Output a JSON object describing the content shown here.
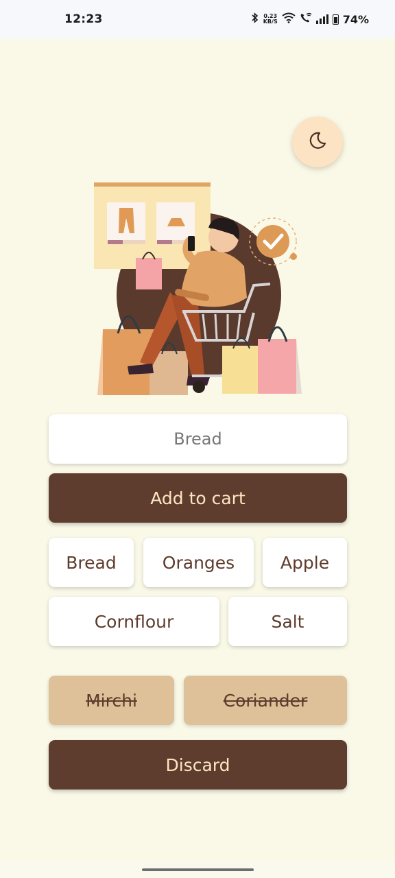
{
  "status_bar": {
    "time": "12:23",
    "net_speed_value": "0.23",
    "net_speed_unit": "KB/S",
    "battery_percent": "74%"
  },
  "theme_toggle": {
    "icon": "moon-icon"
  },
  "illustration": {
    "icon": "shopping-cart-illustration"
  },
  "form": {
    "input_placeholder": "Bread",
    "add_button_label": "Add to cart"
  },
  "cart_items": [
    {
      "label": "Bread",
      "done": false
    },
    {
      "label": "Oranges",
      "done": false
    },
    {
      "label": "Apple",
      "done": false
    },
    {
      "label": "Cornflour",
      "done": false
    },
    {
      "label": "Salt",
      "done": false
    }
  ],
  "completed_items": [
    {
      "label": "Mirchi",
      "done": true
    },
    {
      "label": "Coriander",
      "done": true
    }
  ],
  "discard_button_label": "Discard",
  "colors": {
    "background": "#faf9e8",
    "primary_dark": "#5e3d2f",
    "primary_text_light": "#fde6c2",
    "done_chip": "#dfc199",
    "toggle_bg": "#fbe3c3"
  }
}
